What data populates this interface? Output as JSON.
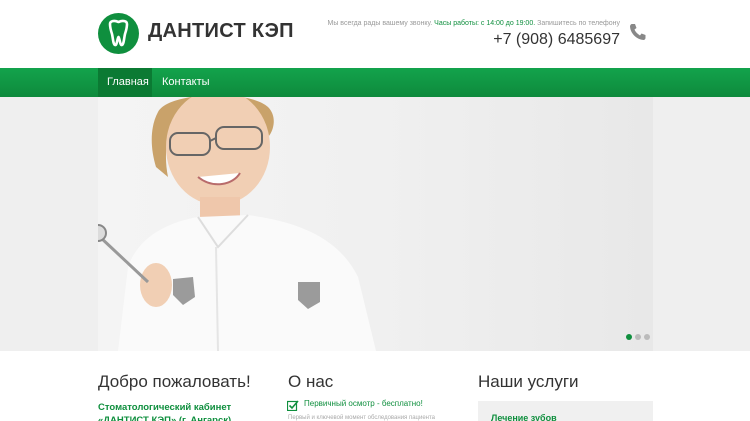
{
  "header": {
    "brand": "ДАНТИСТ КЭП",
    "contact_prefix": "Мы всегда рады вашему звонку. ",
    "hours": "Часы работы: с 14:00 до 19:00.",
    "contact_suffix": " Запишитесь по телефону",
    "phone": "+7 (908) 6485697"
  },
  "nav": {
    "items": [
      {
        "label": "Главная",
        "active": true
      },
      {
        "label": "Контакты",
        "active": false
      }
    ]
  },
  "slider": {
    "slides_count": 3,
    "active_index": 0
  },
  "columns": {
    "welcome": {
      "title": "Добро пожаловать!",
      "subtitle": "Стоматологический кабинет «ДАНТИСТ КЭП» (г. Ангарск)"
    },
    "about": {
      "title": "О нас",
      "item": "Первичный осмотр - бесплатно!",
      "text": "Первый и ключевой момент обследования пациента"
    },
    "services": {
      "title": "Наши услуги",
      "item": "Лечение зубов"
    }
  },
  "colors": {
    "accent": "#0f8f3e",
    "nav": "#13a34c"
  }
}
